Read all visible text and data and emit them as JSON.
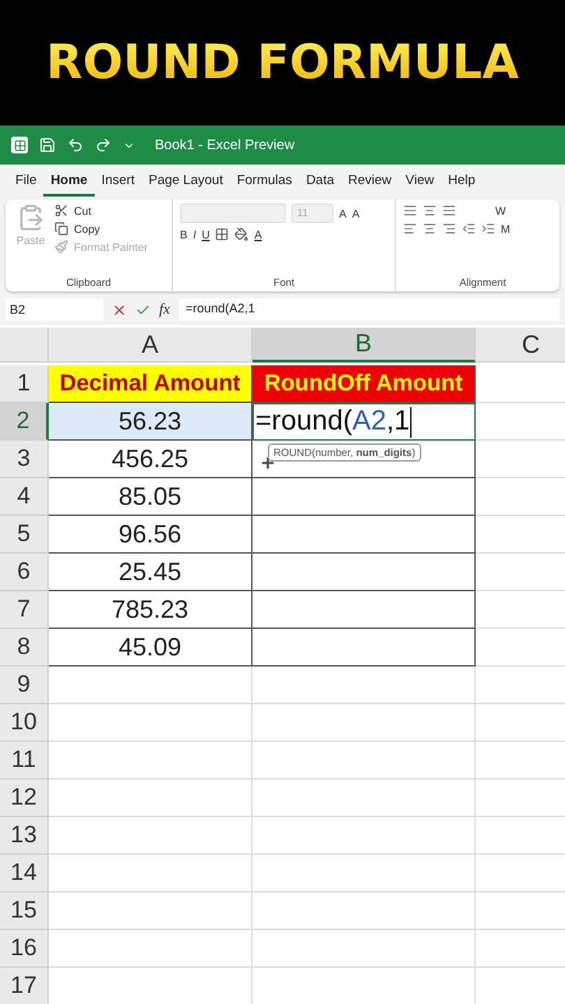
{
  "banner": {
    "title": "ROUND FORMULA"
  },
  "title_bar": {
    "document": "Book1  -  Excel Preview"
  },
  "menu_tabs": [
    {
      "label": "File",
      "selected": false
    },
    {
      "label": "Home",
      "selected": true
    },
    {
      "label": "Insert",
      "selected": false
    },
    {
      "label": "Page Layout",
      "selected": false
    },
    {
      "label": "Formulas",
      "selected": false
    },
    {
      "label": "Data",
      "selected": false
    },
    {
      "label": "Review",
      "selected": false
    },
    {
      "label": "View",
      "selected": false
    },
    {
      "label": "Help",
      "selected": false
    }
  ],
  "ribbon": {
    "clipboard": {
      "paste": "Paste",
      "cut": "Cut",
      "copy": "Copy",
      "format_painter": "Format Painter",
      "label": "Clipboard"
    },
    "font": {
      "size": "11",
      "bold": "B",
      "italic": "I",
      "underline": "U",
      "font_color": "A",
      "grow": "A",
      "shrink": "A",
      "label": "Font"
    },
    "alignment": {
      "wrap": "W",
      "merge": "M",
      "label": "Alignment"
    }
  },
  "formula_bar": {
    "name_box": "B2",
    "function_label": "fx",
    "formula": "=round(A2,1"
  },
  "columns": [
    {
      "label": "A",
      "selected": false
    },
    {
      "label": "B",
      "selected": true
    },
    {
      "label": "C",
      "selected": false
    }
  ],
  "rows": [
    {
      "header": "1",
      "selected": false,
      "cells": [
        {
          "kind": "text",
          "value": "Decimal Amount",
          "color": "#ffff00"
        },
        {
          "kind": "text",
          "value": "RoundOff Amount",
          "color": "#ee0000"
        }
      ]
    },
    {
      "header": "2",
      "selected": true,
      "cells": [
        {
          "kind": "text",
          "value": "56.23",
          "referenced": true
        },
        {
          "kind": "editing",
          "value": "=round(",
          "reference": "A2",
          "suffix": ",1",
          "tooltip": "ROUND(number, **num_digits**)"
        }
      ]
    },
    {
      "header": "3",
      "selected": false,
      "cells": [
        {
          "kind": "text",
          "value": "456.25"
        },
        {
          "kind": "empty"
        }
      ]
    },
    {
      "header": "4",
      "selected": false,
      "cells": [
        {
          "kind": "text",
          "value": "85.05"
        },
        {
          "kind": "empty"
        }
      ]
    },
    {
      "header": "5",
      "selected": false,
      "cells": [
        {
          "kind": "text",
          "value": "96.56"
        },
        {
          "kind": "empty"
        }
      ]
    },
    {
      "header": "6",
      "selected": false,
      "cells": [
        {
          "kind": "text",
          "value": "25.45"
        },
        {
          "kind": "empty"
        }
      ]
    },
    {
      "header": "7",
      "selected": false,
      "cells": [
        {
          "kind": "text",
          "value": "785.23"
        },
        {
          "kind": "empty"
        }
      ]
    },
    {
      "header": "8",
      "selected": false,
      "cells": [
        {
          "kind": "text",
          "value": "45.09"
        },
        {
          "kind": "empty"
        }
      ]
    },
    {
      "header": "9",
      "selected": false,
      "cells": []
    },
    {
      "header": "10",
      "selected": false,
      "cells": []
    },
    {
      "header": "11",
      "selected": false,
      "cells": []
    },
    {
      "header": "12",
      "selected": false,
      "cells": []
    },
    {
      "header": "13",
      "selected": false,
      "cells": []
    },
    {
      "header": "14",
      "selected": false,
      "cells": []
    },
    {
      "header": "15",
      "selected": false,
      "cells": []
    },
    {
      "header": "16",
      "selected": false,
      "cells": []
    },
    {
      "header": "17",
      "selected": false,
      "cells": []
    }
  ]
}
